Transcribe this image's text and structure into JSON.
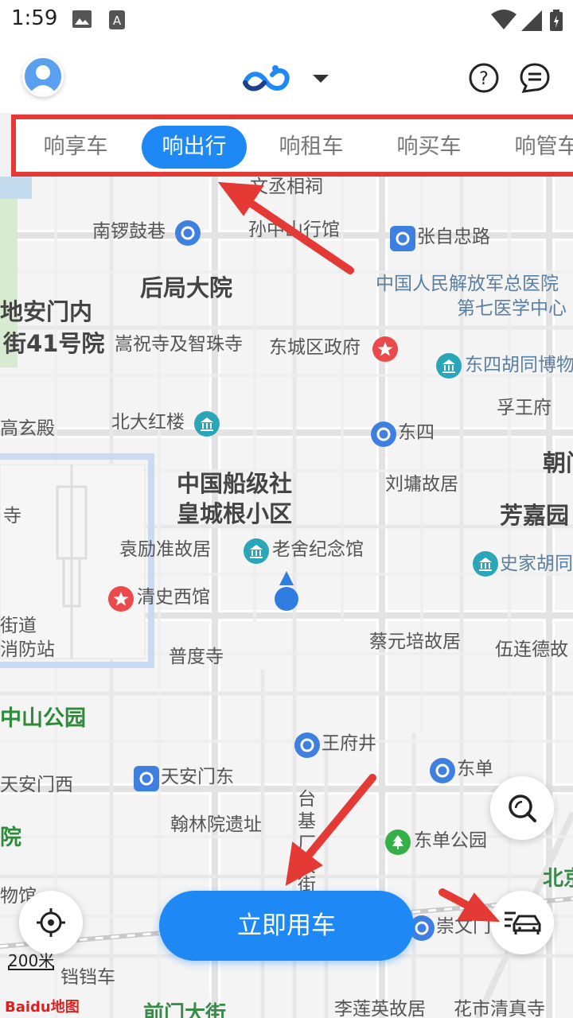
{
  "status_bar": {
    "time": "1:59"
  },
  "tabs": [
    {
      "label": "响享车",
      "active": false
    },
    {
      "label": "响出行",
      "active": true
    },
    {
      "label": "响租车",
      "active": false
    },
    {
      "label": "响买车",
      "active": false
    },
    {
      "label": "响管车",
      "active": false
    }
  ],
  "map_labels": {
    "wenchengxiang": "文丞相祠",
    "nanluoguxiang": "南锣鼓巷",
    "sunzhongshan": "孙中山行馆",
    "zhangzizhong": "张自忠路",
    "houjudayuan": "后局大院",
    "pla_hospital_1": "中国人民解放军总医院",
    "pla_hospital_2": "第七医学中心",
    "dianmen_1": "地安门内",
    "dianmen_2": "街41号院",
    "songzhusi": "嵩祝寺及智珠寺",
    "dongcheng_gov": "东城区政府",
    "dongsi_museum": "东四胡同博物",
    "gaoxuandian": "高玄殿",
    "fuwangfu": "孚王府",
    "beida_honglou": "北大红楼",
    "dongsi": "东四",
    "chao": "朝门",
    "chuanji_1": "中国船级社",
    "chuanji_2": "皇城根小区",
    "liuyong": "刘墉故居",
    "fangjiayuan": "芳嘉园",
    "si": "寺",
    "yuanlizhun": "袁励准故居",
    "laoshe": "老舍纪念馆",
    "shijiahutong": "史家胡同",
    "qingshixiguan": "清史西馆",
    "street_1": "街道",
    "street_2": "消防站",
    "caiyuanpei": "蔡元培故居",
    "wulian": "伍连德故",
    "puduss": "普度寺",
    "zhongshan_park": "中山公园",
    "wangfujing": "王府井",
    "dongdan": "东单",
    "tiananmen_west": "天安门西",
    "tiananmen_east": "天安门东",
    "yuan": "院",
    "hanlinyuan": "翰林院遗址",
    "dongdan_park": "东单公园",
    "taijichang_1": "台",
    "taijichang_2": "基",
    "taijichang_3": "厂",
    "taijichang_4": "大",
    "taijichang_5": "街",
    "beijing_station": "北京",
    "guan": "物馆",
    "chongwenmen": "崇文门",
    "dangdangche": "铛铛车",
    "qianmen": "前门大街",
    "lilianying": "李莲英故居",
    "huashi": "花市清真寺"
  },
  "map_scale": "200米",
  "map_brand": "Baidu地图",
  "cta": {
    "label": "立即用车"
  },
  "colors": {
    "accent": "#1e88f5",
    "highlight_border": "#e53935"
  }
}
